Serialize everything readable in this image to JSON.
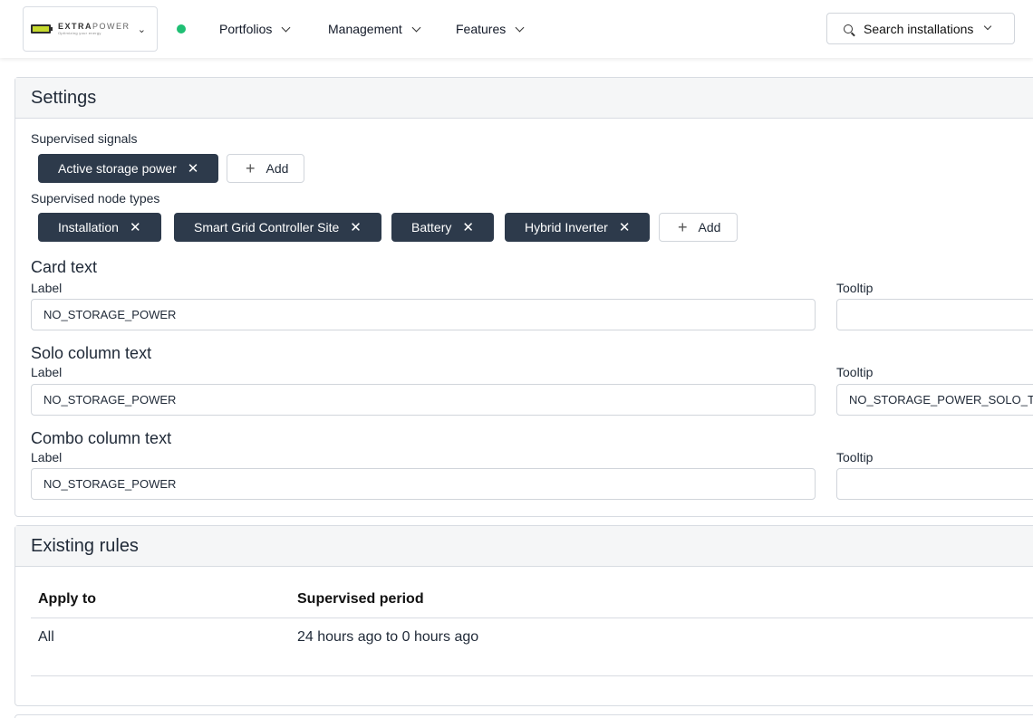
{
  "nav": {
    "brand_word_bold": "EXTRA",
    "brand_word_light": "POWER",
    "brand_tagline": "Optimizing your energy",
    "items": [
      {
        "label": "Portfolios"
      },
      {
        "label": "Management"
      },
      {
        "label": "Features"
      }
    ],
    "search_label": "Search installations",
    "status_color": "#1fbf74"
  },
  "settings": {
    "title": "Settings",
    "signals_label": "Supervised signals",
    "signals": [
      "Active storage power"
    ],
    "node_types_label": "Supervised node types",
    "node_types": [
      "Installation",
      "Smart Grid Controller Site",
      "Battery",
      "Hybrid Inverter"
    ],
    "add_label": "Add",
    "remove_glyph": "✕",
    "card": {
      "title": "Card text",
      "label_caption": "Label",
      "label_value": "NO_STORAGE_POWER",
      "tooltip_caption": "Tooltip",
      "tooltip_value": ""
    },
    "solo": {
      "title": "Solo column text",
      "label_caption": "Label",
      "label_value": "NO_STORAGE_POWER",
      "tooltip_caption": "Tooltip",
      "tooltip_value": "NO_STORAGE_POWER_SOLO_TO"
    },
    "combo": {
      "title": "Combo column text",
      "label_caption": "Label",
      "label_value": "NO_STORAGE_POWER",
      "tooltip_caption": "Tooltip",
      "tooltip_value": ""
    }
  },
  "rules": {
    "title": "Existing rules",
    "columns": [
      "Apply to",
      "Supervised period"
    ],
    "rows": [
      {
        "apply_to": "All",
        "period": "24 hours ago to 0 hours ago"
      }
    ]
  },
  "colors": {
    "chip_bg": "#2d3a4b",
    "accent_green": "#1fbf74",
    "logo_yellow": "#c5d92d"
  }
}
